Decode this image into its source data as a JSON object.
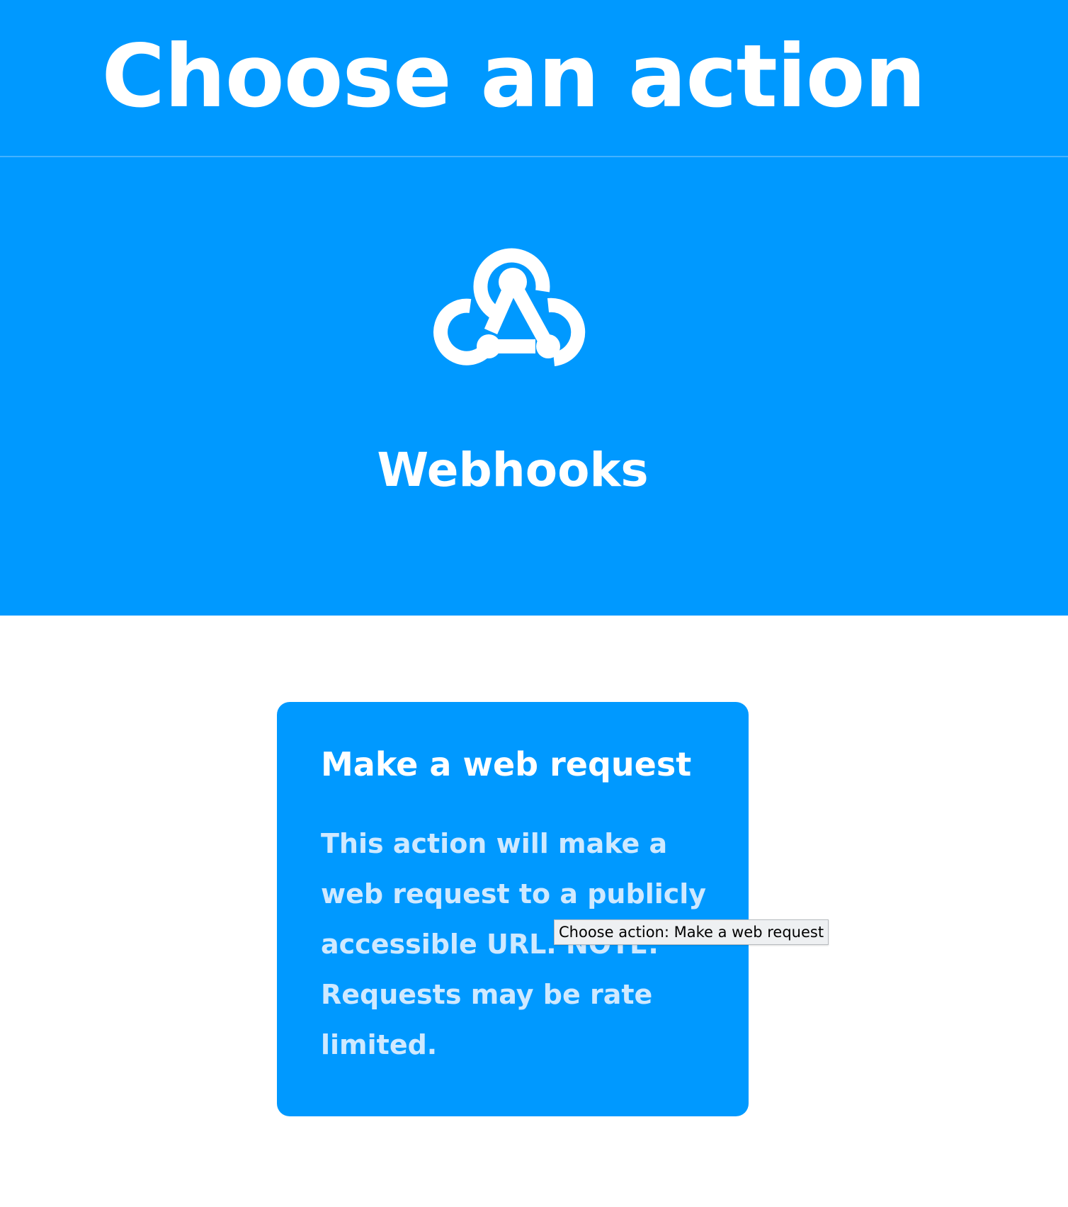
{
  "header": {
    "title": "Choose an action"
  },
  "service": {
    "name": "Webhooks",
    "icon": "webhooks-icon"
  },
  "actions": [
    {
      "title": "Make a web request",
      "description": "This action will make a web request to a publicly accessible URL. NOTE: Requests may be rate limited."
    }
  ],
  "tooltip": {
    "text": "Choose action: Make a web request"
  },
  "colors": {
    "brand": "#0099ff",
    "text_on_brand": "#ffffff",
    "description_text": "#cfe9ff",
    "page_background": "#ffffff"
  }
}
